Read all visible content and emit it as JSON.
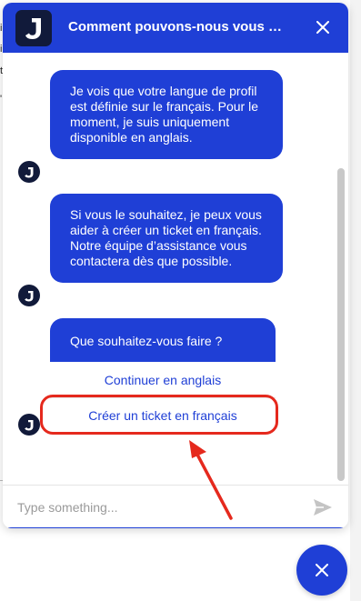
{
  "background": {
    "fragments": [
      "i",
      "i",
      "t",
      "'"
    ]
  },
  "header": {
    "title": "Comment pouvons-nous vous …",
    "logo_icon": "j-logo-icon",
    "close_icon": "close-icon"
  },
  "messages": [
    {
      "text": "Je vois que votre langue de profil est définie sur le français. Pour le moment, je suis uniquement disponible en anglais."
    },
    {
      "text": "Si vous le souhaitez, je peux vous aider à créer un ticket en français. Notre équipe d’assistance vous contactera dès que possible."
    }
  ],
  "choice_card": {
    "question": "Que souhaitez-vous faire ?",
    "options": [
      "Continuer en anglais",
      "Créer un ticket en français"
    ]
  },
  "composer": {
    "placeholder": "Type something...",
    "value": "",
    "send_icon": "send-icon"
  },
  "launcher": {
    "icon": "close-icon"
  },
  "colors": {
    "brand_blue": "#1f3fd6",
    "logo_dark": "#111a3a",
    "highlight_red": "#e5291d"
  }
}
